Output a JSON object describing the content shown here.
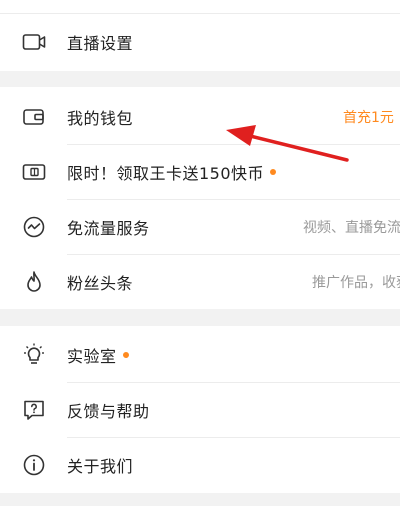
{
  "menu": {
    "live_settings": {
      "label": "直播设置",
      "icon": "video-camera-icon"
    },
    "wallet": {
      "label": "我的钱包",
      "value": "首充1元",
      "icon": "wallet-icon"
    },
    "king_card": {
      "label": "限时！领取王卡送150快币",
      "icon": "sim-card-icon"
    },
    "free_data": {
      "label": "免流量服务",
      "value": "视频、直播免流",
      "icon": "wave-circle-icon"
    },
    "fans_headline": {
      "label": "粉丝头条",
      "value": "推广作品，收获粉丝",
      "icon": "flame-icon"
    },
    "lab": {
      "label": "实验室",
      "icon": "bulb-icon"
    },
    "feedback": {
      "label": "反馈与帮助",
      "icon": "question-chat-icon"
    },
    "about": {
      "label": "关于我们",
      "icon": "info-icon"
    }
  },
  "colors": {
    "accent": "#ff8a1f",
    "arrow": "#e0201f",
    "background": "#f2f2f2"
  }
}
